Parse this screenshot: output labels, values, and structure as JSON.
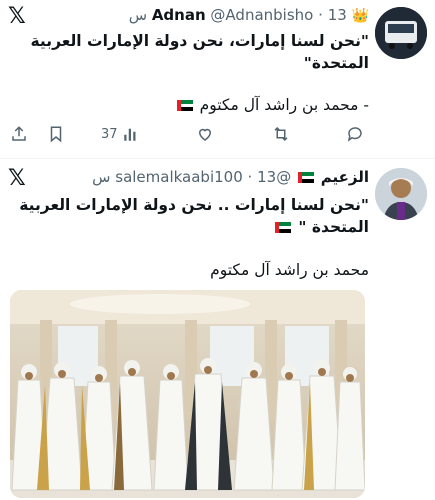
{
  "tweet1": {
    "name": "Adnan",
    "badge_icon": "crown-icon",
    "handle": "@Adnanbisho",
    "separator": "·",
    "time": "13 س",
    "text": "\"نحن لسنا إمارات، نحن دولة الإمارات العربية المتحدة\"",
    "signature": "- محمد بن راشد آل مكتوم",
    "views": "37"
  },
  "tweet2": {
    "name": "الزعيم",
    "handle": "@salemalkaabi100",
    "separator": "·",
    "time": "13 س",
    "text": "\"نحن لسنا إمارات .. نحن دولة الإمارات العربية المتحدة \"",
    "signature": "محمد بن راشد آل مكتوم"
  },
  "colors": {
    "accent": "#1d9bf0",
    "muted": "#536471",
    "text": "#0f1419"
  }
}
